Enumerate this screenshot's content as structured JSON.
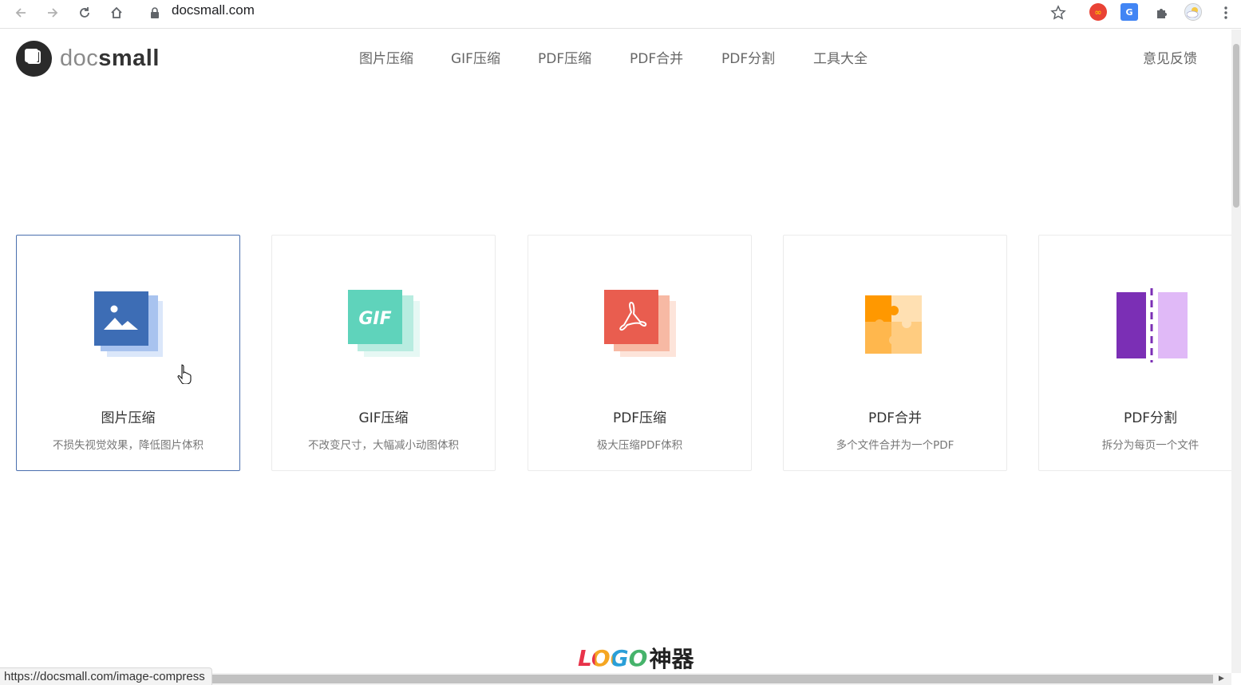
{
  "browser": {
    "url": "docsmall.com",
    "status_url": "https://docsmall.com/image-compress"
  },
  "site": {
    "logo": {
      "doc": "doc",
      "small": "small"
    },
    "nav": [
      {
        "label": "图片压缩"
      },
      {
        "label": "GIF压缩"
      },
      {
        "label": "PDF压缩"
      },
      {
        "label": "PDF合并"
      },
      {
        "label": "PDF分割"
      },
      {
        "label": "工具大全"
      }
    ],
    "feedback": "意见反馈"
  },
  "cards": [
    {
      "title": "图片压缩",
      "desc": "不损失视觉效果，降低图片体积",
      "icon": "image-compress-icon",
      "color": "#3d6db5"
    },
    {
      "title": "GIF压缩",
      "desc": "不改变尺寸，大幅减小动图体积",
      "icon": "gif-compress-icon",
      "icon_text": "GIF",
      "color": "#5fd3bb"
    },
    {
      "title": "PDF压缩",
      "desc": "极大压缩PDF体积",
      "icon": "pdf-compress-icon",
      "color": "#e95d4f"
    },
    {
      "title": "PDF合并",
      "desc": "多个文件合并为一个PDF",
      "icon": "puzzle-icon",
      "color": "#f5a623"
    },
    {
      "title": "PDF分割",
      "desc": "拆分为每页一个文件",
      "icon": "split-icon",
      "color": "#7b2fb5"
    }
  ],
  "watermark": {
    "latin": "LOGO",
    "chinese": "神器"
  }
}
